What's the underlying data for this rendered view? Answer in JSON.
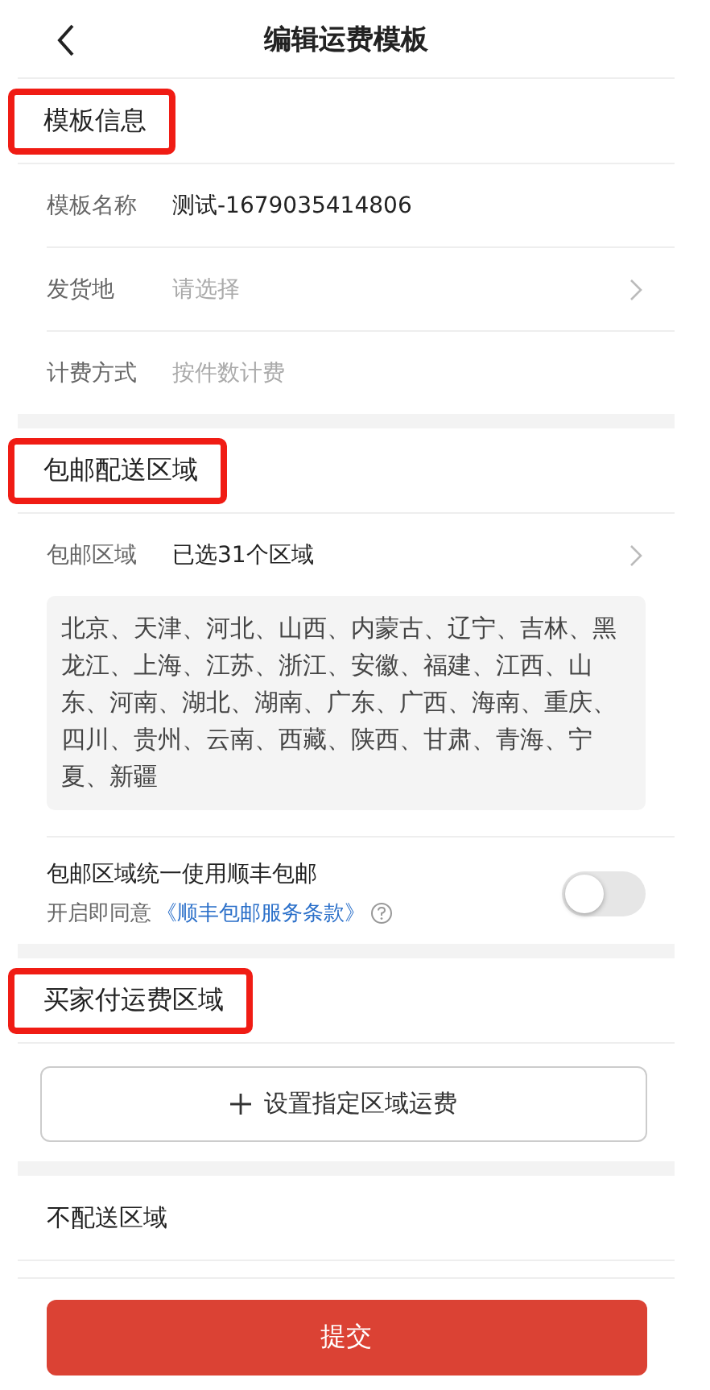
{
  "nav": {
    "title": "编辑运费模板"
  },
  "template_info": {
    "title": "模板信息",
    "highlighted": true,
    "rows": [
      {
        "label": "模板名称",
        "value": "测试-1679035414806",
        "kind": "text"
      },
      {
        "label": "发货地",
        "placeholder": "请选择",
        "kind": "select"
      },
      {
        "label": "计费方式",
        "value": "按件数计费",
        "kind": "static"
      }
    ]
  },
  "free_shipping": {
    "title": "包邮配送区域",
    "highlighted": true,
    "region_row": {
      "label": "包邮区域",
      "value": "已选31个区域"
    },
    "regions": "北京、天津、河北、山西、内蒙古、辽宁、吉林、黑龙江、上海、江苏、浙江、安徽、福建、江西、山东、河南、湖北、湖南、广东、广西、海南、重庆、四川、贵州、云南、西藏、陕西、甘肃、青海、宁夏、新疆",
    "sf_toggle": {
      "label": "包邮区域统一使用顺丰包邮",
      "agree_text": "开启即同意",
      "terms_link": "《顺丰包邮服务条款》",
      "on": false
    }
  },
  "buyer_pays": {
    "title": "买家付运费区域",
    "highlighted": true,
    "add_button": "设置指定区域运费"
  },
  "no_delivery": {
    "title": "不配送区域"
  },
  "submit_button": "提交"
}
